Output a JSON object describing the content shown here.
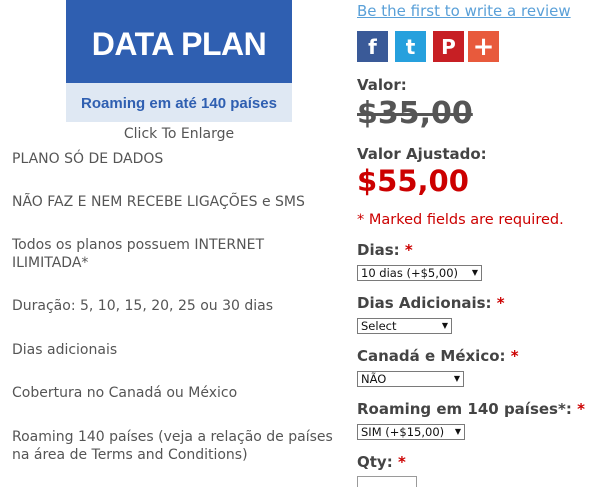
{
  "product_image": {
    "title": "DATA PLAN",
    "subtitle": "Roaming em até 140 países",
    "caption": "Click To Enlarge"
  },
  "description": [
    "PLANO SÓ DE DADOS",
    "NÃO FAZ E NEM RECEBE LIGAÇÕES e SMS",
    "Todos os planos possuem INTERNET ILIMITADA*",
    "Duração: 5, 10, 15, 20, 25 ou 30 dias",
    "Dias adicionais",
    "Cobertura no Canadá ou México",
    "Roaming 140 países (veja a relação de países na área de Terms and Conditions)"
  ],
  "review_link": "Be the first to write a review",
  "share": {
    "facebook": "f",
    "twitter": "t",
    "pinterest": "P",
    "more": "+"
  },
  "pricing": {
    "valor_label": "Valor:",
    "old_price": "$35,00",
    "adjusted_label": "Valor Ajustado:",
    "new_price": "$55,00",
    "required_note": "* Marked fields are required."
  },
  "options": {
    "required_mark": "*",
    "dias": {
      "label": "Dias:",
      "value": "10 dias (+$5,00)"
    },
    "dias_adicionais": {
      "label": "Dias Adicionais:",
      "value": "Select"
    },
    "canada_mexico": {
      "label": "Canadá e México:",
      "value": "NÃO"
    },
    "roaming": {
      "label": "Roaming em 140 países*:",
      "value": "SIM (+$15,00)"
    },
    "qty": {
      "label": "Qty:"
    }
  },
  "colors": {
    "accent_red": "#cc0000",
    "link_blue": "#5aa0d8",
    "image_blue": "#2f5fb1"
  }
}
